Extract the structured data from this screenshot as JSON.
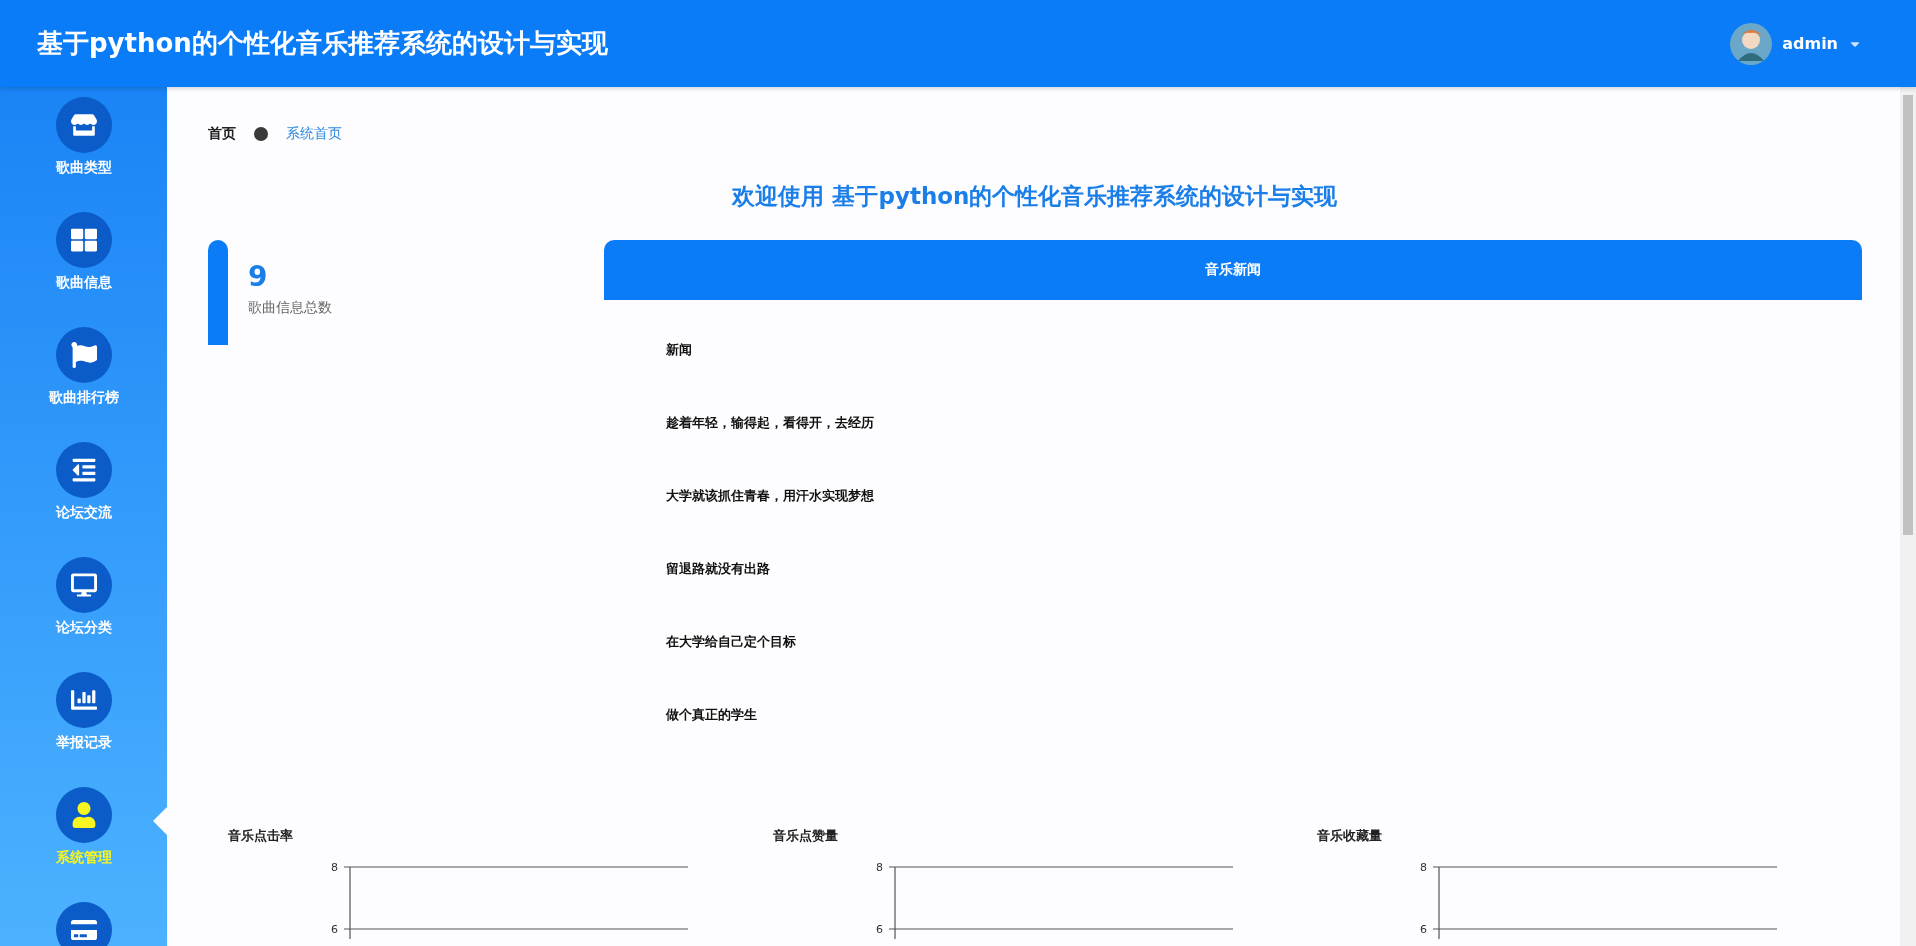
{
  "header": {
    "title": "基于python的个性化音乐推荐系统的设计与实现",
    "user": "admin"
  },
  "sidebar": {
    "items": [
      {
        "label": "歌曲类型",
        "selected": false
      },
      {
        "label": "歌曲信息",
        "selected": false
      },
      {
        "label": "歌曲排行榜",
        "selected": false
      },
      {
        "label": "论坛交流",
        "selected": false
      },
      {
        "label": "论坛分类",
        "selected": false
      },
      {
        "label": "举报记录",
        "selected": false
      },
      {
        "label": "系统管理",
        "selected": true
      },
      {
        "selected": false
      }
    ]
  },
  "breadcrumb": {
    "home": "首页",
    "current": "系统首页"
  },
  "welcome": "欢迎使用 基于python的个性化音乐推荐系统的设计与实现",
  "stat": {
    "value": "9",
    "label": "歌曲信息总数"
  },
  "news": {
    "title": "音乐新闻",
    "items": [
      "新闻",
      "趁着年轻，输得起，看得开，去经历",
      "大学就该抓住青春，用汗水实现梦想",
      "留退路就没有出路",
      "在大学给自己定个目标",
      "做个真正的学生"
    ]
  },
  "charts": [
    {
      "title": "音乐点击率",
      "y_ticks": [
        "8",
        "6"
      ]
    },
    {
      "title": "音乐点赞量",
      "y_ticks": [
        "8",
        "6"
      ]
    },
    {
      "title": "音乐收藏量",
      "y_ticks": [
        "8",
        "6"
      ]
    }
  ]
}
